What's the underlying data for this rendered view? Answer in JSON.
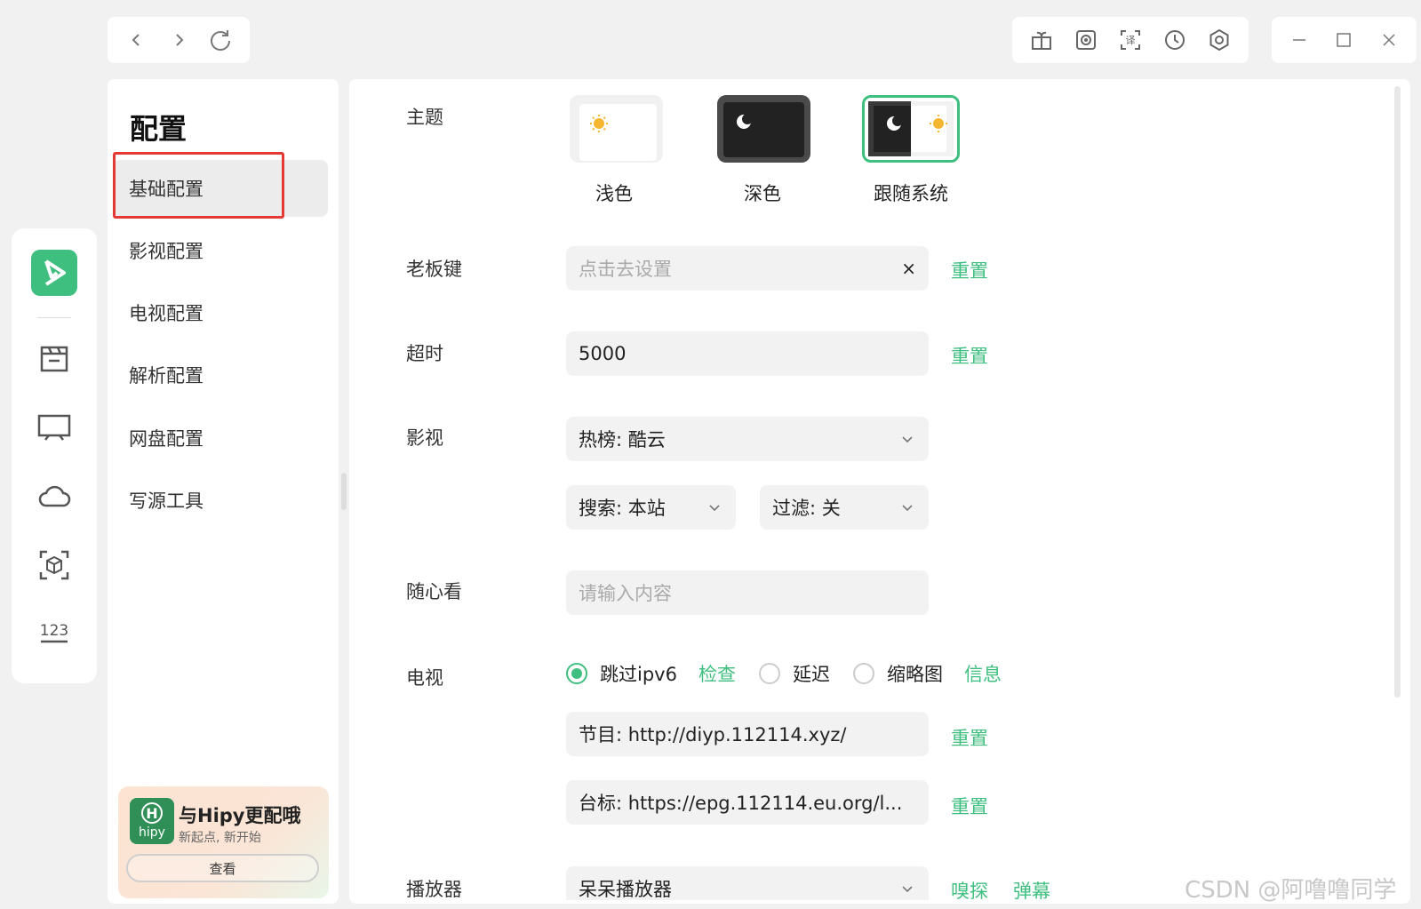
{
  "nav": {
    "back_icon": "chevron-left",
    "forward_icon": "chevron-right",
    "refresh_icon": "refresh"
  },
  "toolbar": {
    "icons": [
      "gift-icon",
      "record-icon",
      "translate-icon",
      "history-icon",
      "settings-icon"
    ]
  },
  "window": {
    "icons": [
      "minimize-icon",
      "maximize-icon",
      "close-icon"
    ]
  },
  "rail": {
    "icons": [
      "film-icon",
      "tv-icon",
      "cloud-icon",
      "cube-scan-icon",
      "numbers-icon"
    ],
    "accent": "#3fbf7f"
  },
  "menu": {
    "title": "配置",
    "items": [
      {
        "label": "基础配置",
        "active": true
      },
      {
        "label": "影视配置"
      },
      {
        "label": "电视配置"
      },
      {
        "label": "解析配置"
      },
      {
        "label": "网盘配置"
      },
      {
        "label": "写源工具"
      }
    ]
  },
  "promo": {
    "logo_text": "hipy",
    "logo_letter": "H",
    "title": "与Hipy更配哦",
    "subtitle": "新起点, 新开始",
    "button": "查看"
  },
  "form": {
    "theme": {
      "label": "主题",
      "options": [
        "浅色",
        "深色",
        "跟随系统"
      ],
      "selected": "跟随系统"
    },
    "boss_key": {
      "label": "老板键",
      "placeholder": "点击去设置",
      "clear": "×",
      "reset": "重置"
    },
    "timeout": {
      "label": "超时",
      "value": "5000",
      "reset": "重置"
    },
    "film": {
      "label": "影视",
      "hot": "热榜: 酷云",
      "search": "搜索: 本站",
      "filter": "过滤: 关"
    },
    "casual": {
      "label": "随心看",
      "placeholder": "请输入内容"
    },
    "tv": {
      "label": "电视",
      "opt1": "跳过ipv6",
      "check": "检查",
      "opt2": "延迟",
      "opt3": "缩略图",
      "info": "信息",
      "program": "节目: http://diyp.112114.xyz/",
      "logo": "台标: https://epg.112114.eu.org/l...",
      "reset": "重置"
    },
    "player": {
      "label": "播放器",
      "value": "呆呆播放器",
      "sniff": "嗅探",
      "danmaku": "弹幕"
    }
  },
  "watermark": "CSDN @阿噜噜同学"
}
